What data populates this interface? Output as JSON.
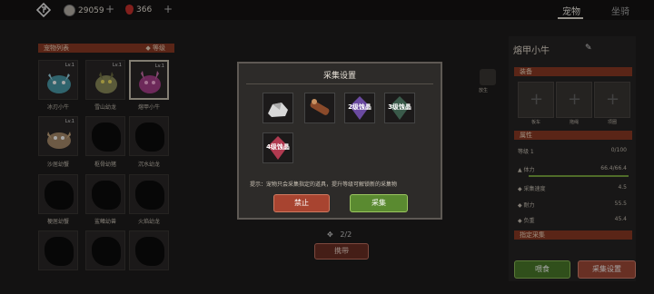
{
  "topbar": {
    "coins": "29059",
    "blood": "366",
    "tabs": [
      "宠物",
      "坐骑"
    ]
  },
  "left": {
    "list_title": "宠物列表",
    "sort_label": "等级",
    "pets": [
      {
        "name": "冰刃小牛",
        "lv": "Lv.1"
      },
      {
        "name": "雪山幼龙",
        "lv": "Lv.1"
      },
      {
        "name": "熔甲小牛",
        "lv": "Lv.1"
      },
      {
        "name": "沙居幼蟹",
        "lv": "Lv.1"
      },
      {
        "name": "枢骨幼猪",
        "lv": ""
      },
      {
        "name": "沉水幼龙",
        "lv": ""
      },
      {
        "name": "梗居幼蟹",
        "lv": ""
      },
      {
        "name": "鲨鳍幼兽",
        "lv": ""
      },
      {
        "name": "火焰幼龙",
        "lv": ""
      }
    ]
  },
  "center": {
    "page": "2/2",
    "carry_label": "携带"
  },
  "dialog": {
    "title": "采集设置",
    "items": [
      "",
      "",
      "2级蚀晶",
      "3级蚀晶",
      "4级蚀晶"
    ],
    "tip": "提示：宠物只会采集指定的道具，提升等级可解锁新的采集物",
    "forbid_label": "禁止",
    "collect_label": "采集"
  },
  "right": {
    "title": "熔甲小牛",
    "side_label": "放生",
    "equip_head": "装备",
    "equip_slots": [
      "板车",
      "拖绳",
      "项圈"
    ],
    "attr_head": "属性",
    "level_label": "等级 1",
    "level_value": "0/100",
    "attrs": [
      {
        "label": "体力",
        "value": "66.4/66.4"
      },
      {
        "label": "采集速度",
        "value": "4.5"
      },
      {
        "label": "耐力",
        "value": "55.5"
      },
      {
        "label": "负重",
        "value": "45.4"
      }
    ],
    "collect_head": "指定采集",
    "feed_label": "喂食",
    "collect_setting_label": "采集设置"
  },
  "colors": {
    "accent_red": "#8a3a24",
    "green": "#5a8a30"
  }
}
